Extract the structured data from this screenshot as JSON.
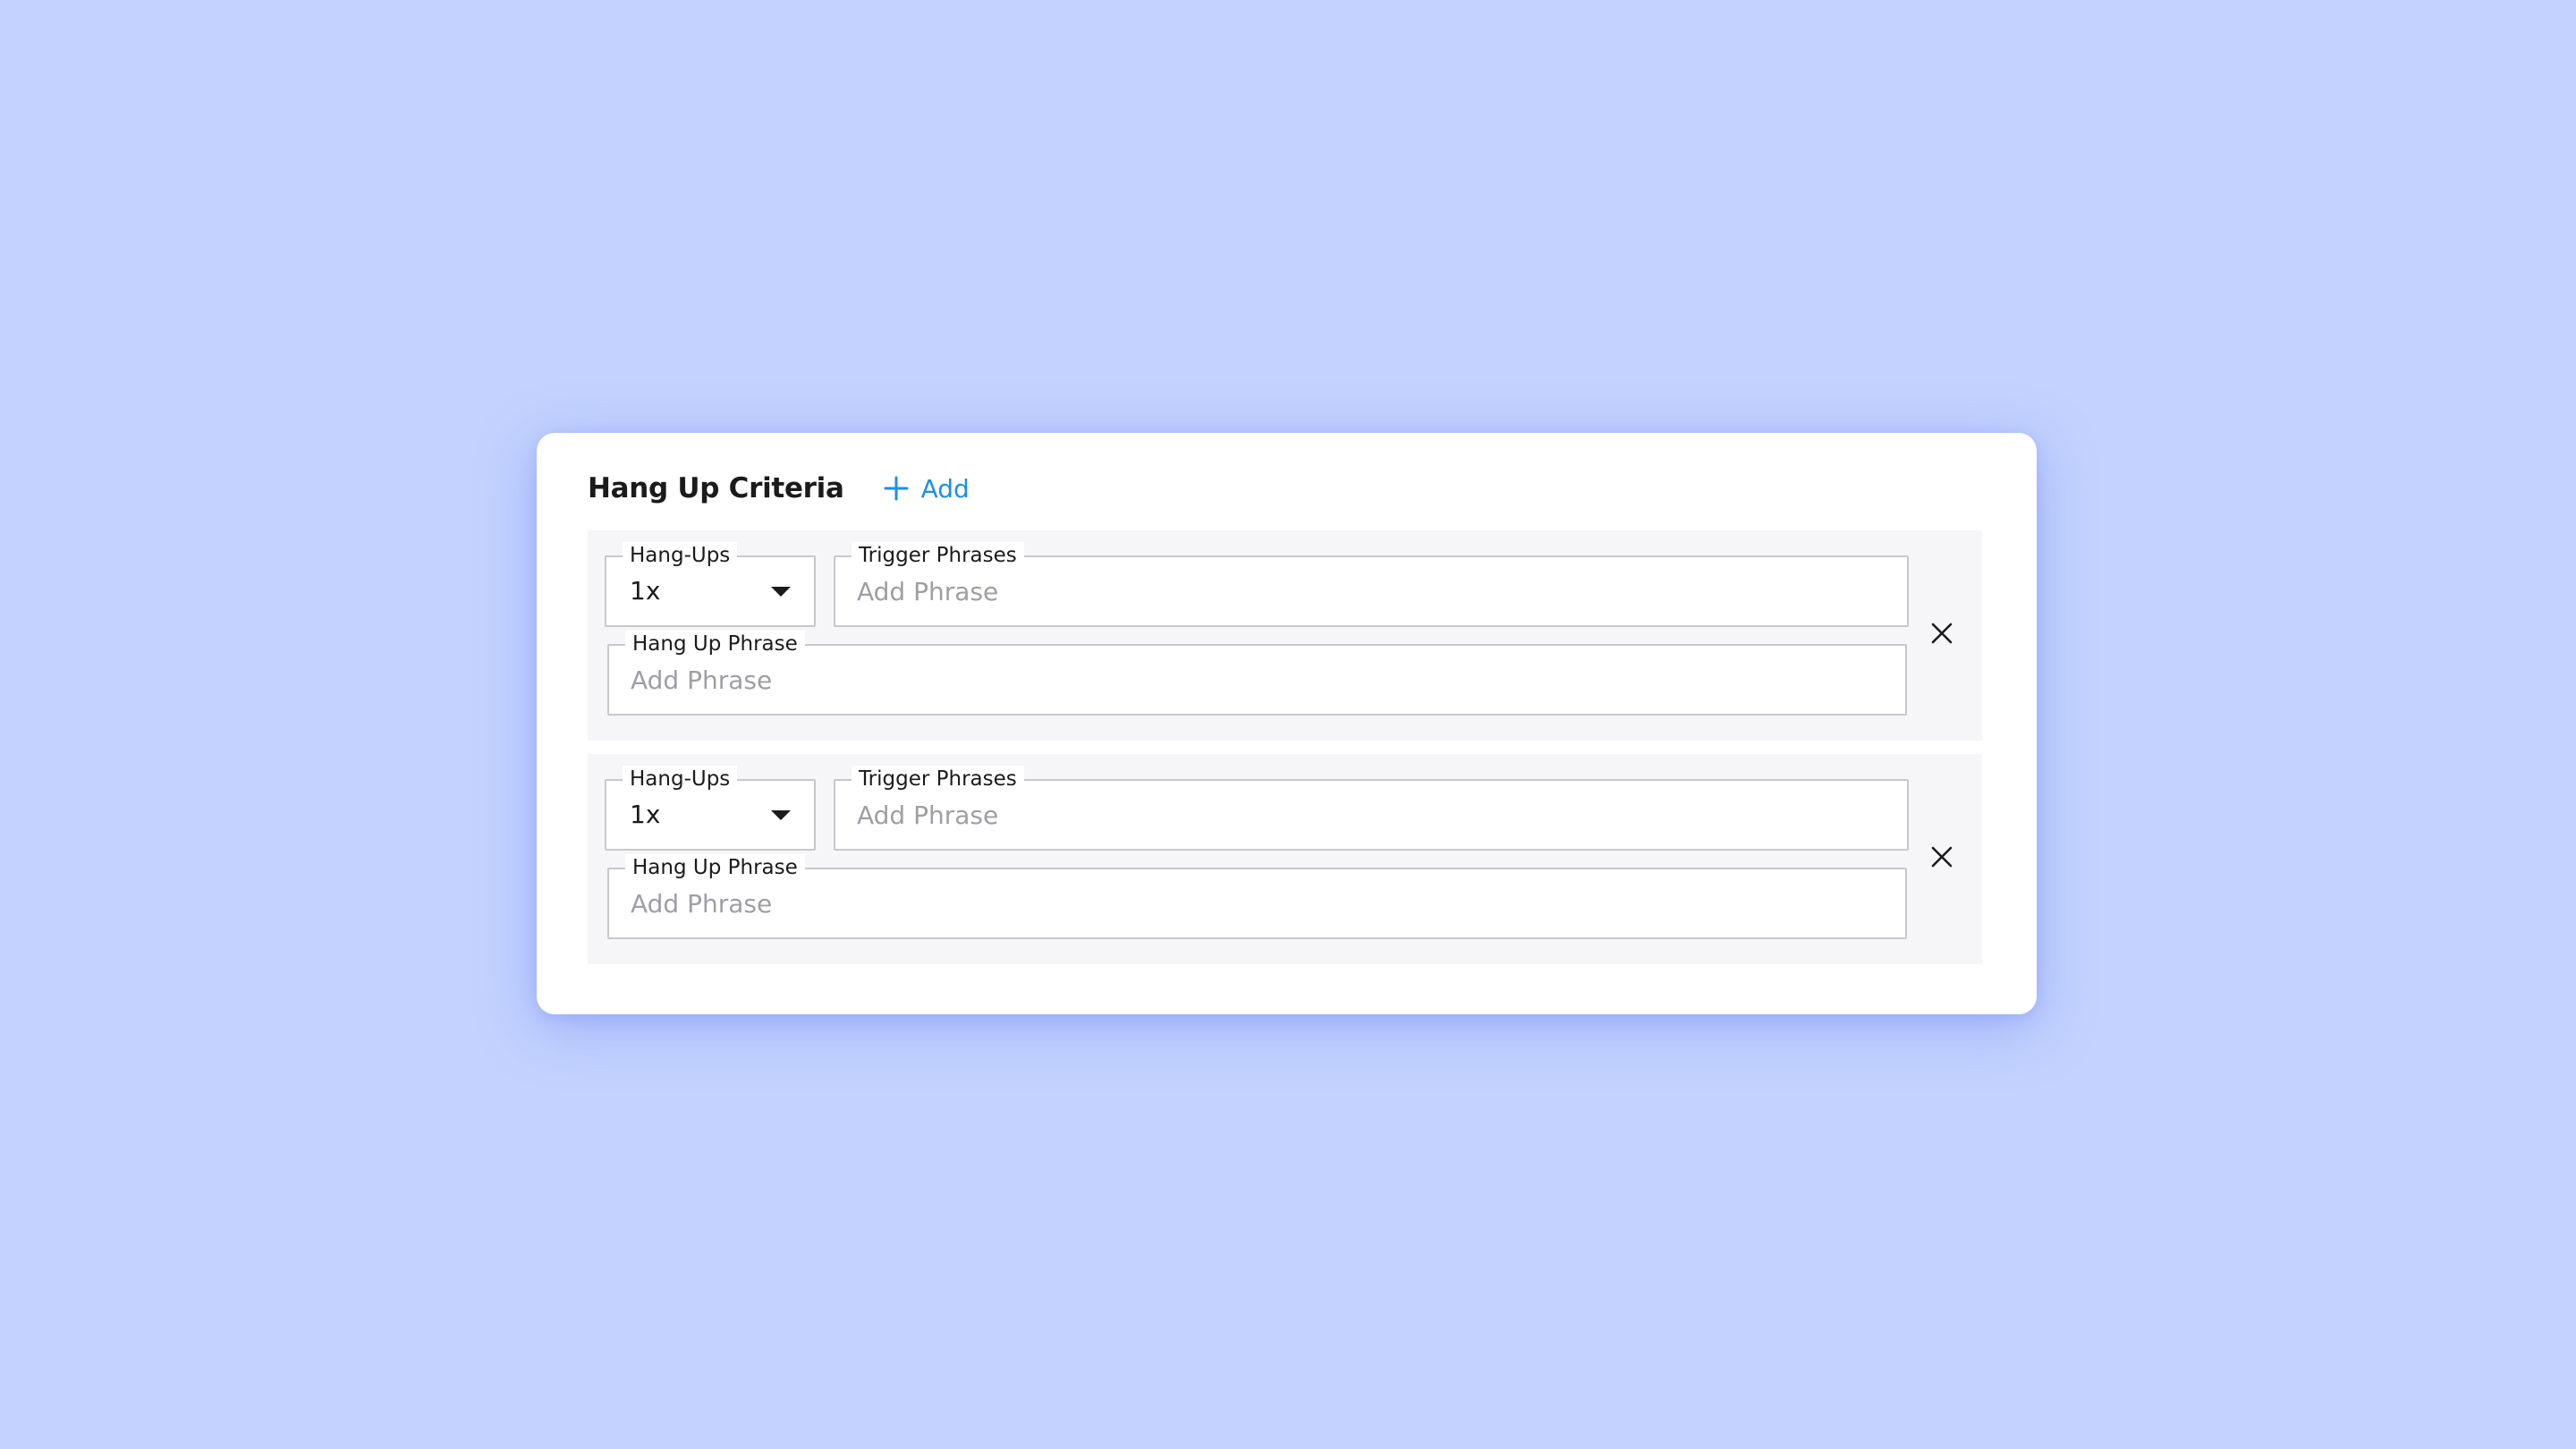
{
  "card": {
    "title": "Hang Up Criteria",
    "add_label": "Add",
    "icons": {
      "add": "plus-icon",
      "remove": "close-icon",
      "dropdown": "caret-down-icon"
    },
    "colors": {
      "accent": "#1d8fe6",
      "background": "#c3d2fe",
      "row_background": "#f6f6f8",
      "placeholder": "#9e9ea6"
    }
  },
  "rows": [
    {
      "hangups_label": "Hang-Ups",
      "hangups_value": "1x",
      "trigger_label": "Trigger Phrases",
      "trigger_placeholder": "Add Phrase",
      "hangup_phrase_label": "Hang Up Phrase",
      "hangup_phrase_placeholder": "Add Phrase"
    },
    {
      "hangups_label": "Hang-Ups",
      "hangups_value": "1x",
      "trigger_label": "Trigger Phrases",
      "trigger_placeholder": "Add Phrase",
      "hangup_phrase_label": "Hang Up Phrase",
      "hangup_phrase_placeholder": "Add Phrase"
    }
  ]
}
